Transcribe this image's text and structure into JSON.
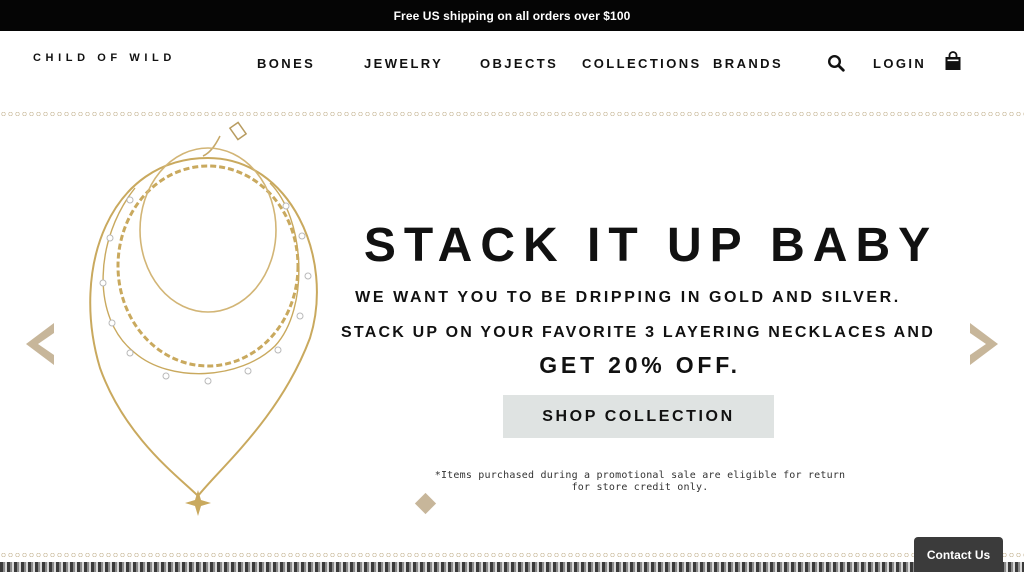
{
  "announcement": {
    "text": "Free US shipping on all orders over $100"
  },
  "header": {
    "logo": "CHILD OF WILD",
    "nav": [
      "BONES",
      "JEWELRY",
      "OBJECTS",
      "COLLECTIONS",
      "BRANDS"
    ],
    "login": "LOGIN",
    "icons": {
      "search": "search-icon",
      "cart": "shopping-bag-icon"
    }
  },
  "hero": {
    "headline": "STACK IT UP BABY",
    "line1": "WE WANT YOU TO BE DRIPPING IN GOLD AND SILVER.",
    "line2": "STACK UP ON YOUR FAVORITE 3 LAYERING NECKLACES AND",
    "line3": "GET 20% OFF.",
    "cta": "SHOP COLLECTION",
    "disclaimer": "*Items purchased during a promotional sale are eligible for return for store credit only.",
    "prev_icon": "chevron-left-icon",
    "next_icon": "chevron-right-icon"
  },
  "contact": {
    "label": "Contact Us"
  },
  "colors": {
    "accent": "#c7b69a",
    "cta_bg": "#dfe3e2",
    "topbar_bg": "#050505"
  }
}
